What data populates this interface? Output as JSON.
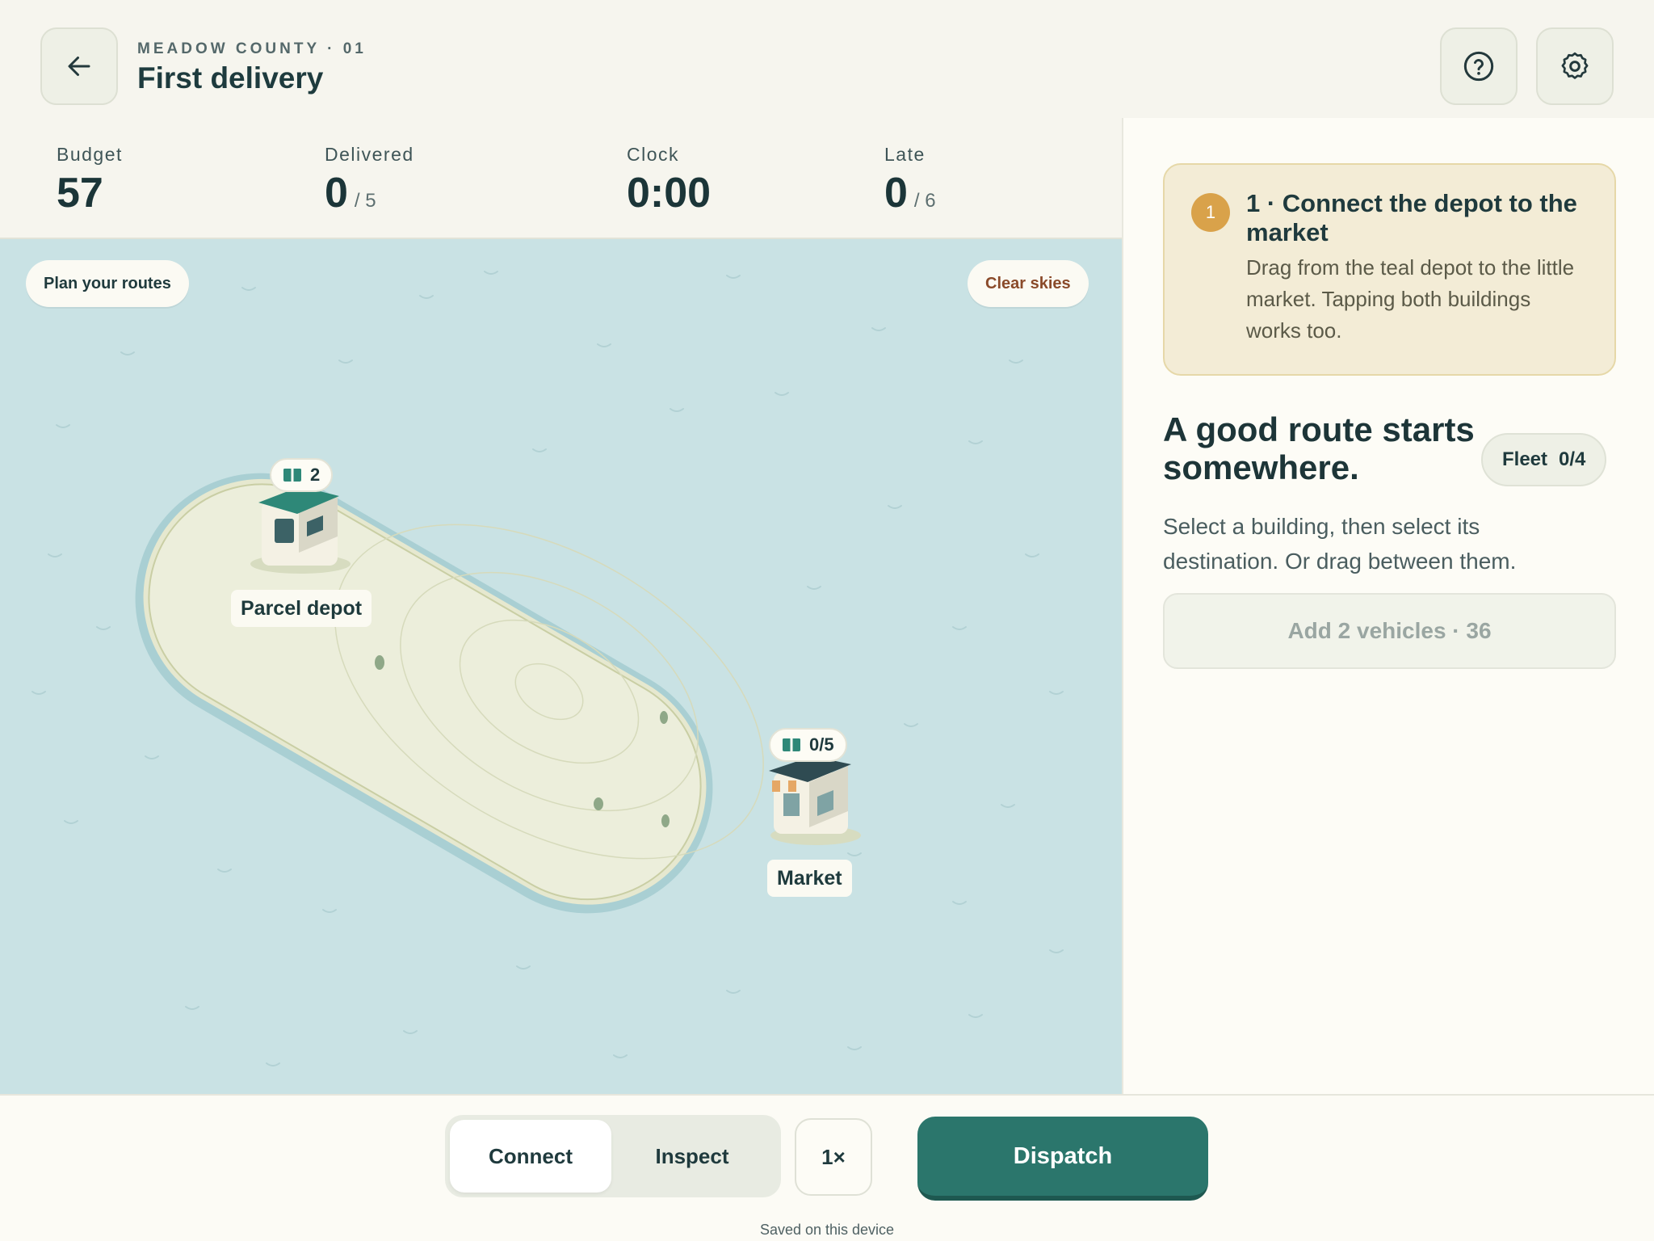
{
  "header": {
    "kicker": "MEADOW COUNTY · 01",
    "title": "First delivery",
    "back_icon": "arrow-left-icon",
    "help_icon": "question-circle-icon",
    "settings_icon": "gear-icon"
  },
  "stats": {
    "budget": {
      "label": "Budget",
      "value": "57"
    },
    "delivered": {
      "label": "Delivered",
      "value": "0",
      "total": "/ 5"
    },
    "clock": {
      "label": "Clock",
      "value": "0:00"
    },
    "late": {
      "label": "Late",
      "value": "0",
      "total": "/ 6"
    }
  },
  "map": {
    "plan_label": "Plan your routes",
    "weather_label": "Clear skies",
    "depot": {
      "name": "Parcel depot",
      "parcels": "2"
    },
    "market": {
      "name": "Market",
      "parcels": "0/5"
    }
  },
  "panel": {
    "hint": {
      "step": "1",
      "title": "1 · Connect the depot to the market",
      "body": "Drag from the teal depot to the little market. Tapping both buildings works too."
    },
    "headline": "A good route starts somewhere.",
    "fleet": {
      "label": "Fleet",
      "value": "0/4"
    },
    "description": "Select a building, then select its destination. Or drag between them.",
    "add_button": "Add 2 vehicles · 36"
  },
  "bottom": {
    "modes": [
      "Connect",
      "Inspect"
    ],
    "active_mode": "Connect",
    "speed": "1×",
    "dispatch": "Dispatch",
    "saved": "Saved on this device"
  },
  "colors": {
    "accent": "#2b766c",
    "water": "#c9e2e4",
    "hint_bg": "#f3ecd6",
    "step_dot": "#d9a24a",
    "weather_text": "#8a4a2a"
  }
}
